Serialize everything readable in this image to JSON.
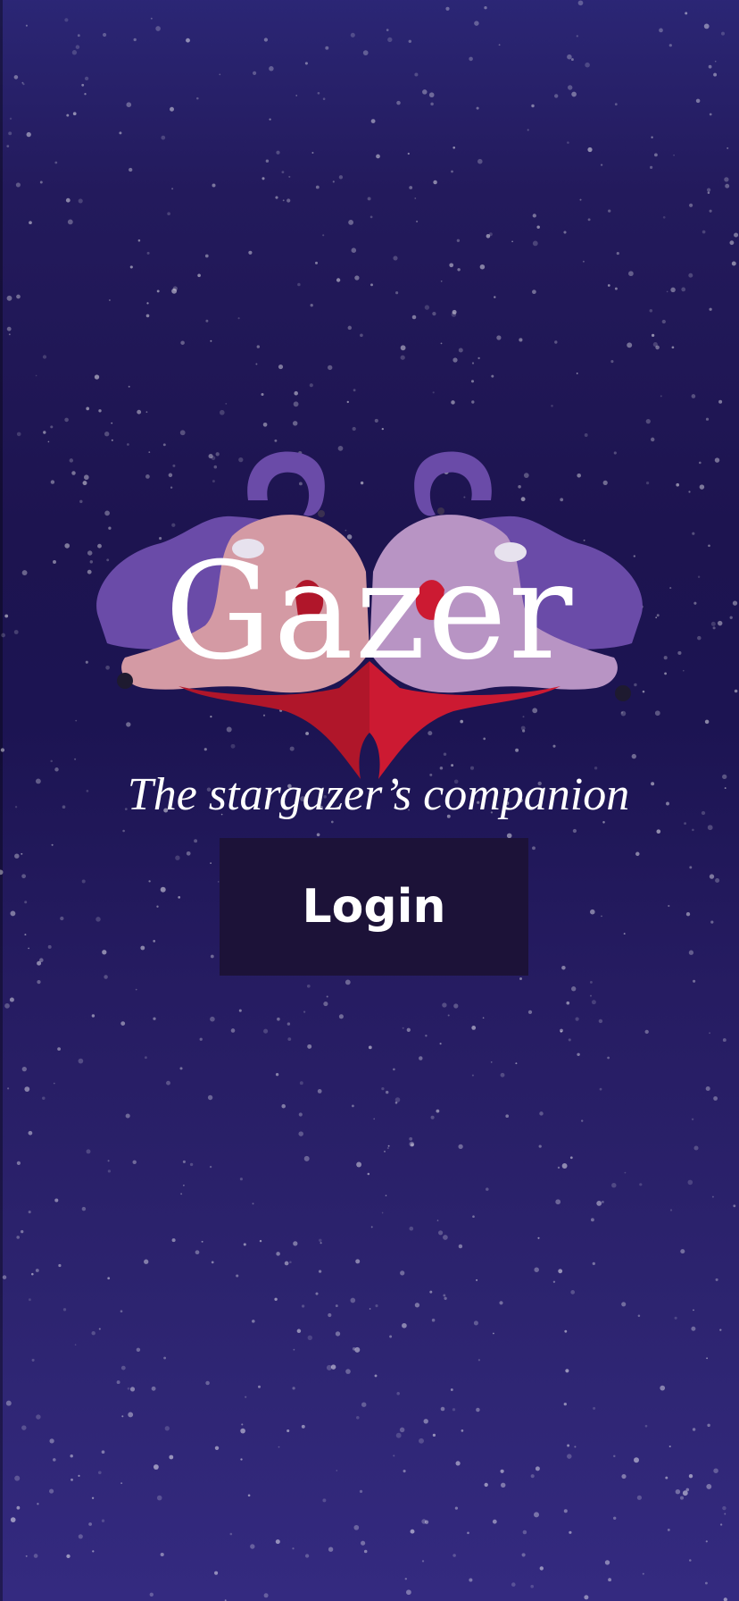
{
  "app": {
    "title": "Gazer",
    "tagline": "The stargazer’s companion"
  },
  "actions": {
    "login_label": "Login"
  },
  "colors": {
    "background_top": "#2b2675",
    "background_mid": "#1c1452",
    "background_bottom": "#342a80",
    "button_bg": "#1c1238",
    "logo_purple": "#6a4ba8",
    "logo_pink": "#d49aa4",
    "logo_lavender": "#b894c4",
    "logo_red": "#c5162e"
  },
  "icons": {
    "logo": "inkblot-logo",
    "background": "starfield"
  }
}
